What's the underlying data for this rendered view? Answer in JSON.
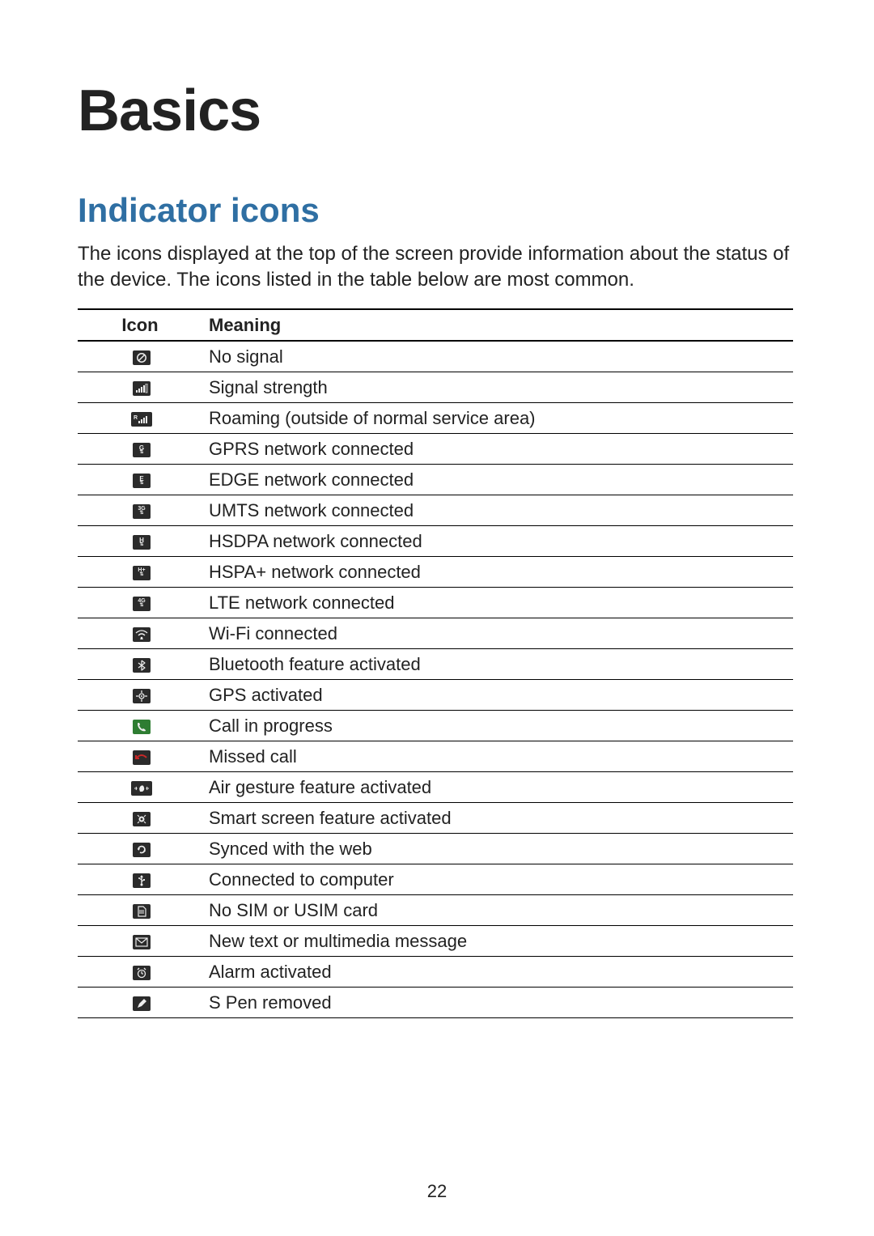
{
  "chapter_title": "Basics",
  "section_title": "Indicator icons",
  "intro_text": "The icons displayed at the top of the screen provide information about the status of the device. The icons listed in the table below are most common.",
  "table": {
    "header_icon": "Icon",
    "header_meaning": "Meaning",
    "rows": [
      {
        "icon_name": "no-signal-icon",
        "meaning": "No signal"
      },
      {
        "icon_name": "signal-strength-icon",
        "meaning": "Signal strength"
      },
      {
        "icon_name": "roaming-icon",
        "meaning": "Roaming (outside of normal service area)"
      },
      {
        "icon_name": "gprs-icon",
        "meaning": "GPRS network connected"
      },
      {
        "icon_name": "edge-icon",
        "meaning": "EDGE network connected"
      },
      {
        "icon_name": "umts-icon",
        "meaning": "UMTS network connected"
      },
      {
        "icon_name": "hsdpa-icon",
        "meaning": "HSDPA network connected"
      },
      {
        "icon_name": "hspa-plus-icon",
        "meaning": "HSPA+ network connected"
      },
      {
        "icon_name": "lte-icon",
        "meaning": "LTE network connected"
      },
      {
        "icon_name": "wifi-icon",
        "meaning": "Wi-Fi connected"
      },
      {
        "icon_name": "bluetooth-icon",
        "meaning": "Bluetooth feature activated"
      },
      {
        "icon_name": "gps-icon",
        "meaning": "GPS activated"
      },
      {
        "icon_name": "call-icon",
        "meaning": "Call in progress"
      },
      {
        "icon_name": "missed-call-icon",
        "meaning": "Missed call"
      },
      {
        "icon_name": "air-gesture-icon",
        "meaning": "Air gesture feature activated"
      },
      {
        "icon_name": "smart-screen-icon",
        "meaning": "Smart screen feature activated"
      },
      {
        "icon_name": "sync-icon",
        "meaning": "Synced with the web"
      },
      {
        "icon_name": "usb-icon",
        "meaning": "Connected to computer"
      },
      {
        "icon_name": "no-sim-icon",
        "meaning": "No SIM or USIM card"
      },
      {
        "icon_name": "message-icon",
        "meaning": "New text or multimedia message"
      },
      {
        "icon_name": "alarm-icon",
        "meaning": "Alarm activated"
      },
      {
        "icon_name": "s-pen-icon",
        "meaning": "S Pen removed"
      }
    ]
  },
  "page_number": "22"
}
